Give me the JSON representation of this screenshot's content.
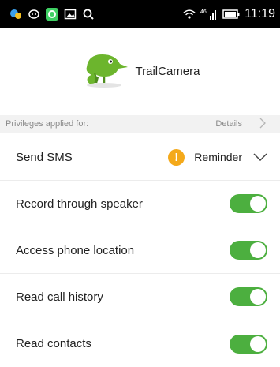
{
  "statusbar": {
    "time": "11:19",
    "left_icons": [
      "app-icon",
      "messenger-icon",
      "qq-icon",
      "gallery-icon",
      "search-icon"
    ],
    "right_icons": [
      "wifi-icon",
      "signal-icon",
      "battery-icon"
    ],
    "signal_text": "46"
  },
  "app": {
    "name": "TrailCamera",
    "icon": "chameleon-icon"
  },
  "privileges": {
    "header": "Privileges applied for:",
    "details_label": "Details",
    "items": [
      {
        "label": "Send SMS",
        "control": "dropdown",
        "value": "Reminder"
      },
      {
        "label": "Record through speaker",
        "control": "toggle",
        "on": true
      },
      {
        "label": "Access phone location",
        "control": "toggle",
        "on": true
      },
      {
        "label": "Read call history",
        "control": "toggle",
        "on": true
      },
      {
        "label": "Read contacts",
        "control": "toggle",
        "on": true
      }
    ]
  },
  "colors": {
    "toggle_on": "#4caf3f",
    "warning": "#f4a91a",
    "app_icon_green": "#6cb52d"
  }
}
